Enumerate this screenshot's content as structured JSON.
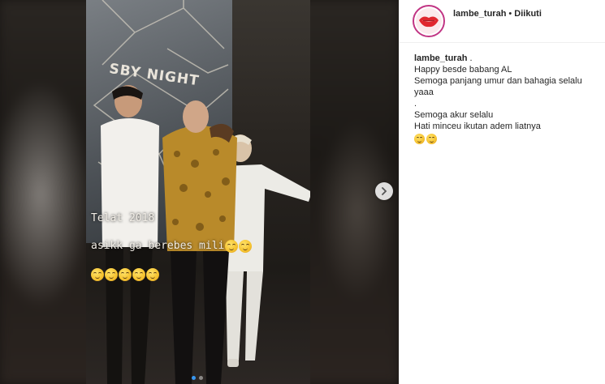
{
  "post": {
    "overlay_line1": "Telat 2018",
    "overlay_line2": "asikk ga berebes mili",
    "overlay_emojis_row1": [
      "crying-laughing-emoji",
      "crying-laughing-emoji"
    ],
    "overlay_emojis_row2": [
      "crying-laughing-emoji",
      "crying-laughing-emoji",
      "crying-laughing-emoji",
      "crying-laughing-emoji",
      "crying-laughing-emoji"
    ],
    "backdrop_sign": "SBY NIGHT",
    "carousel": {
      "count": 2,
      "active_index": 0
    }
  },
  "header": {
    "username": "lambe_turah",
    "separator": "•",
    "follow_status": "Diikuti"
  },
  "caption": {
    "username": "lambe_turah",
    "username_suffix": " .",
    "lines": [
      "Happy besde babang AL",
      "Semoga panjang umur dan bahagia selalu",
      "yaaa",
      ".",
      "Semoga akur selalu",
      "Hati minceu ikutan adem liatnya"
    ],
    "emojis": [
      "crying-laughing-emoji",
      "crying-laughing-emoji"
    ]
  },
  "colors": {
    "accent_dot": "#3897f0",
    "avatar_ring": "#c13584",
    "text": "#262626"
  }
}
